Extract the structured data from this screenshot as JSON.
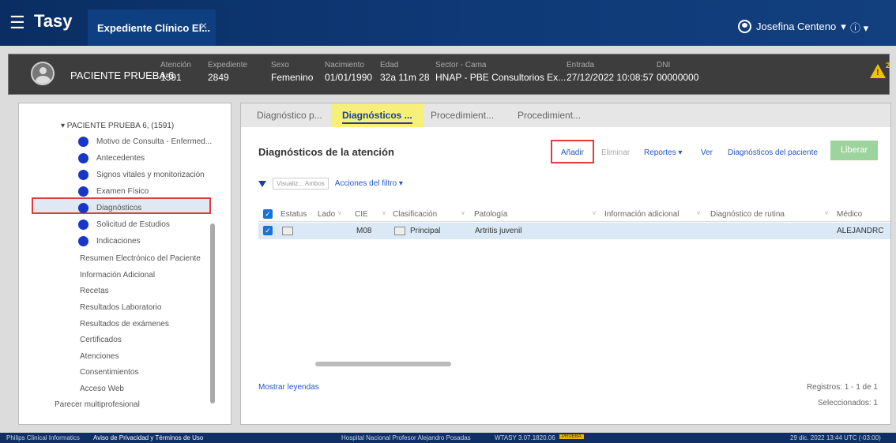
{
  "app": {
    "logo": "Tasy",
    "tab_label": "Expediente Clínico El...",
    "user_name": "Josefina Centeno",
    "user_caret": "▾",
    "info_label": "ⓘ ▾"
  },
  "patient": {
    "name": "PACIENTE PRUEBA 6",
    "fields": [
      {
        "label": "Atención",
        "value": "1591"
      },
      {
        "label": "Expediente",
        "value": "2849"
      },
      {
        "label": "Sexo",
        "value": "Femenino"
      },
      {
        "label": "Nacimiento",
        "value": "01/01/1990"
      },
      {
        "label": "Edad",
        "value": "32a 11m 28"
      },
      {
        "label": "Sector - Cama",
        "value": "HNAP - PBE Consultorios Ex..."
      },
      {
        "label": "Entrada",
        "value": "27/12/2022 10:08:57"
      },
      {
        "label": "DNI",
        "value": "00000000"
      }
    ],
    "alert_count": "2",
    "alert_mark": "!"
  },
  "tree": {
    "root": "▾ PACIENTE PRUEBA 6, (1591)",
    "items": [
      {
        "label": "Motivo de Consulta - Enfermed..."
      },
      {
        "label": "Antecedentes"
      },
      {
        "label": "Signos vitales y monitorización"
      },
      {
        "label": "Examen Físico"
      },
      {
        "label": "Diagnósticos"
      },
      {
        "label": "Solicitud de Estudios"
      },
      {
        "label": "Indicaciones"
      }
    ],
    "plain": [
      {
        "label": "Resumen Electrónico del Paciente"
      },
      {
        "label": "Información Adicional"
      },
      {
        "label": "Recetas"
      },
      {
        "label": "Resultados Laboratorio"
      },
      {
        "label": "Resultados de exámenes"
      },
      {
        "label": "Certificados"
      },
      {
        "label": "Atenciones"
      },
      {
        "label": "Consentimientos"
      },
      {
        "label": "Acceso Web"
      },
      {
        "label": "Parecer multiprofesional"
      }
    ]
  },
  "tabs": [
    {
      "label": "Diagnóstico p..."
    },
    {
      "label": "Diagnósticos ..."
    },
    {
      "label": "Procedimient..."
    },
    {
      "label": "Procedimient..."
    }
  ],
  "section": {
    "title": "Diagnósticos de la atención",
    "add": "Añadir",
    "delete": "Eliminar",
    "reports": "Reportes ▾",
    "view": "Ver",
    "patient_diagnoses": "Diagnósticos del paciente",
    "release": "Liberar"
  },
  "filter": {
    "view_box": "Visualiz... Ambos",
    "actions": "Acciones del filtro ▾"
  },
  "grid": {
    "columns": [
      "Estatus",
      "Lado",
      "CIE",
      "Clasificación",
      "Patología",
      "Información adicional",
      "Diagnóstico de rutina",
      "Médico"
    ],
    "rows": [
      {
        "cie": "M08",
        "clasificacion": "Principal",
        "patologia": "Artritis juvenil",
        "medico": "ALEJANDRC"
      }
    ]
  },
  "bottom": {
    "legend_link": "Mostrar leyendas",
    "records": "Registros: 1 - 1 de 1",
    "selected": "Seleccionados: 1"
  },
  "footer": {
    "left_a": "Philips Clinical Informatics",
    "left_b": "Aviso de Privacidad y Términos de Uso",
    "center": "Hospital Nacional Profesor Alejandro Posadas",
    "version": "WTASY 3.07.1820.06",
    "badge": "PRUEBA",
    "right": "29 dic. 2022 13:44 UTC (-03:00)"
  }
}
